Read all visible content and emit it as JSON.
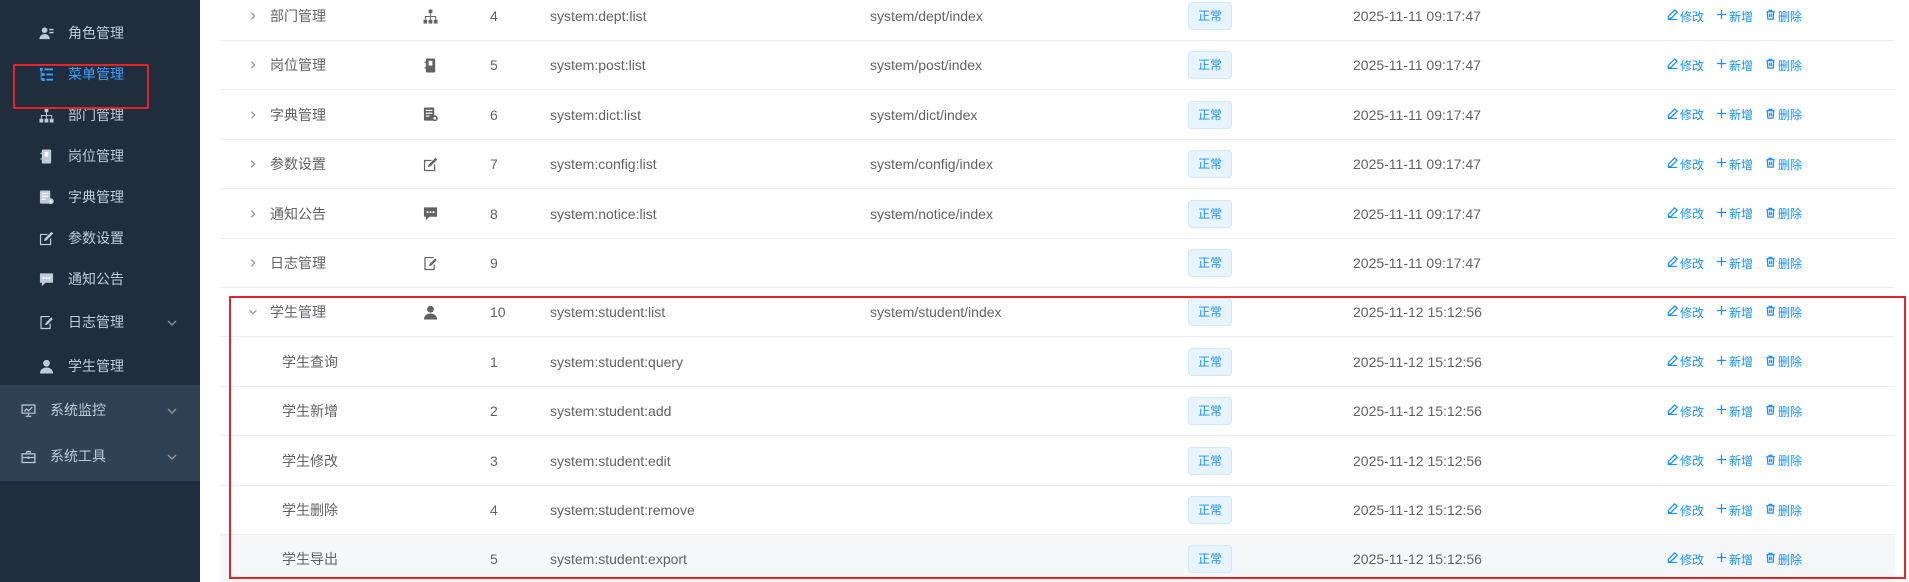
{
  "sidebar": {
    "items": [
      {
        "label": "角色管理",
        "icon": "user-role-icon",
        "has_arrow": false,
        "active": false,
        "top_level": false
      },
      {
        "label": "菜单管理",
        "icon": "tree-table-icon",
        "has_arrow": false,
        "active": true,
        "top_level": false
      },
      {
        "label": "部门管理",
        "icon": "tree-icon",
        "has_arrow": false,
        "active": false,
        "top_level": false
      },
      {
        "label": "岗位管理",
        "icon": "post-icon",
        "has_arrow": false,
        "active": false,
        "top_level": false
      },
      {
        "label": "字典管理",
        "icon": "dict-icon",
        "has_arrow": false,
        "active": false,
        "top_level": false
      },
      {
        "label": "参数设置",
        "icon": "edit-icon",
        "has_arrow": false,
        "active": false,
        "top_level": false
      },
      {
        "label": "通知公告",
        "icon": "message-icon",
        "has_arrow": false,
        "active": false,
        "top_level": false
      },
      {
        "label": "日志管理",
        "icon": "log-icon",
        "has_arrow": true,
        "active": false,
        "top_level": false
      },
      {
        "label": "学生管理",
        "icon": "user-icon",
        "has_arrow": false,
        "active": false,
        "top_level": false
      },
      {
        "label": "系统监控",
        "icon": "monitor-icon",
        "has_arrow": true,
        "active": false,
        "top_level": true
      },
      {
        "label": "系统工具",
        "icon": "tool-icon",
        "has_arrow": true,
        "active": false,
        "top_level": true
      }
    ]
  },
  "table": {
    "ops": {
      "edit": "修改",
      "add": "新增",
      "delete": "删除"
    },
    "rows": [
      {
        "name": "部门管理",
        "icon": "tree-icon",
        "order": "4",
        "perm": "system:dept:list",
        "component": "system/dept/index",
        "status": "正常",
        "time": "2025-11-11 09:17:47",
        "expand": "collapsed",
        "child": false
      },
      {
        "name": "岗位管理",
        "icon": "post-icon",
        "order": "5",
        "perm": "system:post:list",
        "component": "system/post/index",
        "status": "正常",
        "time": "2025-11-11 09:17:47",
        "expand": "collapsed",
        "child": false
      },
      {
        "name": "字典管理",
        "icon": "dict-icon",
        "order": "6",
        "perm": "system:dict:list",
        "component": "system/dict/index",
        "status": "正常",
        "time": "2025-11-11 09:17:47",
        "expand": "collapsed",
        "child": false
      },
      {
        "name": "参数设置",
        "icon": "edit-icon",
        "order": "7",
        "perm": "system:config:list",
        "component": "system/config/index",
        "status": "正常",
        "time": "2025-11-11 09:17:47",
        "expand": "collapsed",
        "child": false
      },
      {
        "name": "通知公告",
        "icon": "message-icon",
        "order": "8",
        "perm": "system:notice:list",
        "component": "system/notice/index",
        "status": "正常",
        "time": "2025-11-11 09:17:47",
        "expand": "collapsed",
        "child": false
      },
      {
        "name": "日志管理",
        "icon": "log-icon",
        "order": "9",
        "perm": "",
        "component": "",
        "status": "正常",
        "time": "2025-11-11 09:17:47",
        "expand": "collapsed",
        "child": false
      },
      {
        "name": "学生管理",
        "icon": "user-icon",
        "order": "10",
        "perm": "system:student:list",
        "component": "system/student/index",
        "status": "正常",
        "time": "2025-11-12 15:12:56",
        "expand": "expanded",
        "child": false
      },
      {
        "name": "学生查询",
        "icon": "",
        "order": "1",
        "perm": "system:student:query",
        "component": "",
        "status": "正常",
        "time": "2025-11-12 15:12:56",
        "expand": "none",
        "child": true
      },
      {
        "name": "学生新增",
        "icon": "",
        "order": "2",
        "perm": "system:student:add",
        "component": "",
        "status": "正常",
        "time": "2025-11-12 15:12:56",
        "expand": "none",
        "child": true
      },
      {
        "name": "学生修改",
        "icon": "",
        "order": "3",
        "perm": "system:student:edit",
        "component": "",
        "status": "正常",
        "time": "2025-11-12 15:12:56",
        "expand": "none",
        "child": true
      },
      {
        "name": "学生删除",
        "icon": "",
        "order": "4",
        "perm": "system:student:remove",
        "component": "",
        "status": "正常",
        "time": "2025-11-12 15:12:56",
        "expand": "none",
        "child": true
      },
      {
        "name": "学生导出",
        "icon": "",
        "order": "5",
        "perm": "system:student:export",
        "component": "",
        "status": "正常",
        "time": "2025-11-12 15:12:56",
        "expand": "none",
        "child": true,
        "hover": true
      }
    ]
  },
  "colors": {
    "sidebar_bg": "#1f2d3d",
    "sidebar_top_bg": "#304156",
    "accent": "#1890ff",
    "highlight_border": "#e3242b"
  }
}
